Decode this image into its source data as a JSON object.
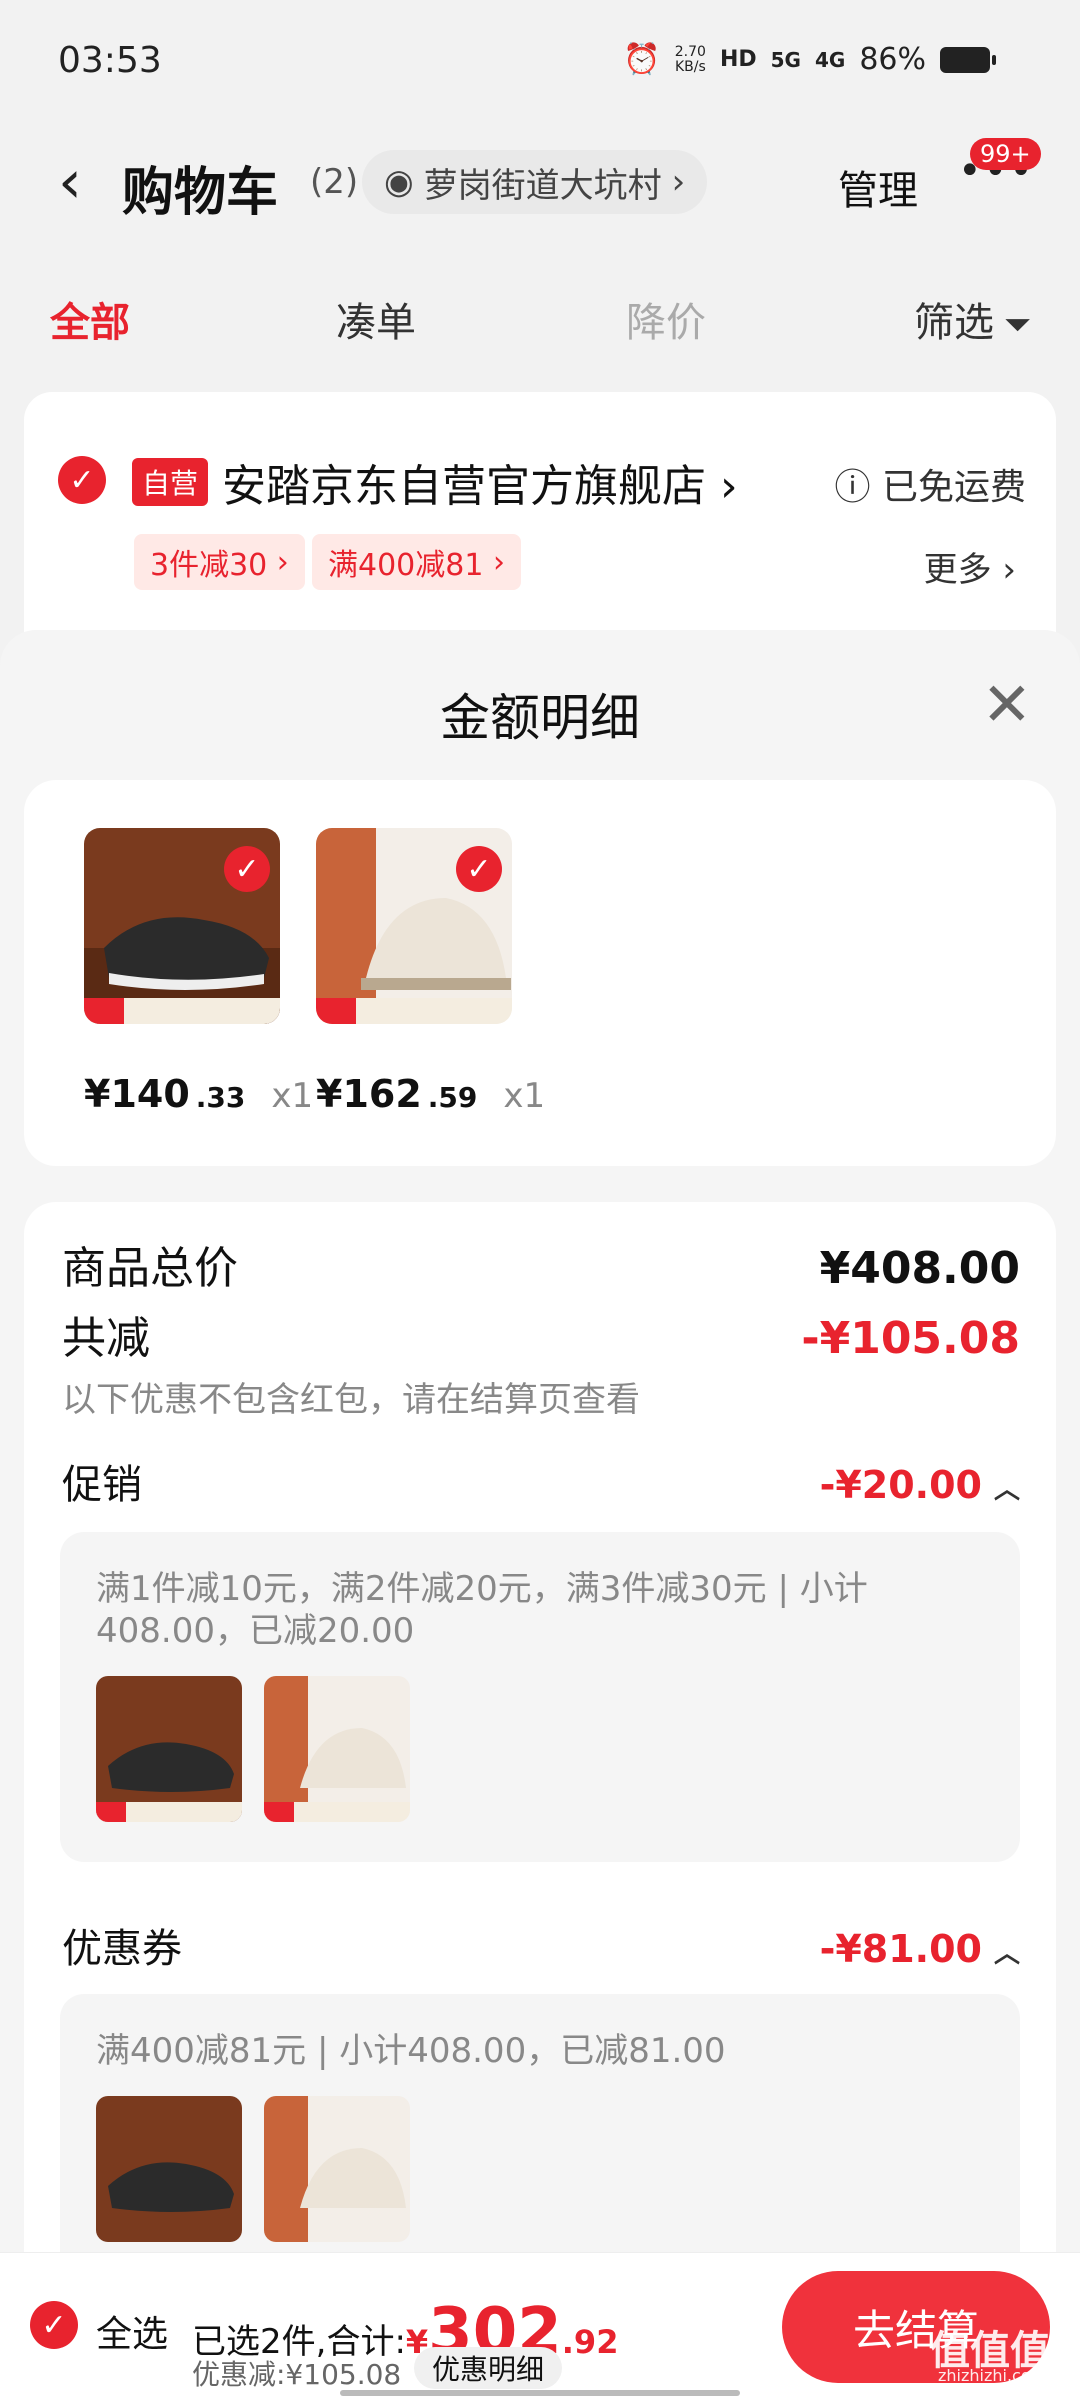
{
  "status": {
    "time": "03:53",
    "net_speed": "2.70",
    "net_unit": "KB/s",
    "hd": "HD",
    "sig5g": "5G",
    "sig4g": "4G",
    "battery": "86%"
  },
  "nav": {
    "title": "购物车",
    "count": "(2)",
    "address": "萝岗街道大坑村",
    "manage": "管理",
    "badge": "99+"
  },
  "tabs": {
    "all": "全部",
    "bundle": "凑单",
    "price_drop": "降价",
    "filter": "筛选"
  },
  "store": {
    "badge": "自营",
    "name": "安踏京东自营官方旗舰店",
    "shipping": "已免运费",
    "promo1": "3件减30",
    "promo2": "满400减81",
    "more": "更多"
  },
  "sheet": {
    "title": "金额明细",
    "products": [
      {
        "price_int": "¥140",
        "price_dec": ".33",
        "qty": "x1"
      },
      {
        "price_int": "¥162",
        "price_dec": ".59",
        "qty": "x1"
      }
    ],
    "goods_total_label": "商品总价",
    "goods_total": "¥408.00",
    "discount_label": "共减",
    "discount_total": "-¥105.08",
    "discount_note": "以下优惠不包含红包，请在结算页查看",
    "promo_label": "促销",
    "promo_value": "-¥20.00",
    "promo_desc": "满1件减10元，满2件减20元，满3件减30元 | 小计408.00，已减20.00",
    "coupon_label": "优惠券",
    "coupon_value": "-¥81.00",
    "coupon_desc": "满400减81元 | 小计408.00，已减81.00"
  },
  "bottom": {
    "select_all": "全选",
    "selected": "已选2件,合计:",
    "currency": "¥",
    "total_int": "302",
    "total_dec": ".92",
    "discount": "优惠减:¥105.08",
    "detail_btn": "优惠明细",
    "checkout": "去结算"
  },
  "watermark": {
    "main": "值值值",
    "sub": "zhizhizhi.com"
  },
  "colors": {
    "accent": "#e8232e"
  }
}
